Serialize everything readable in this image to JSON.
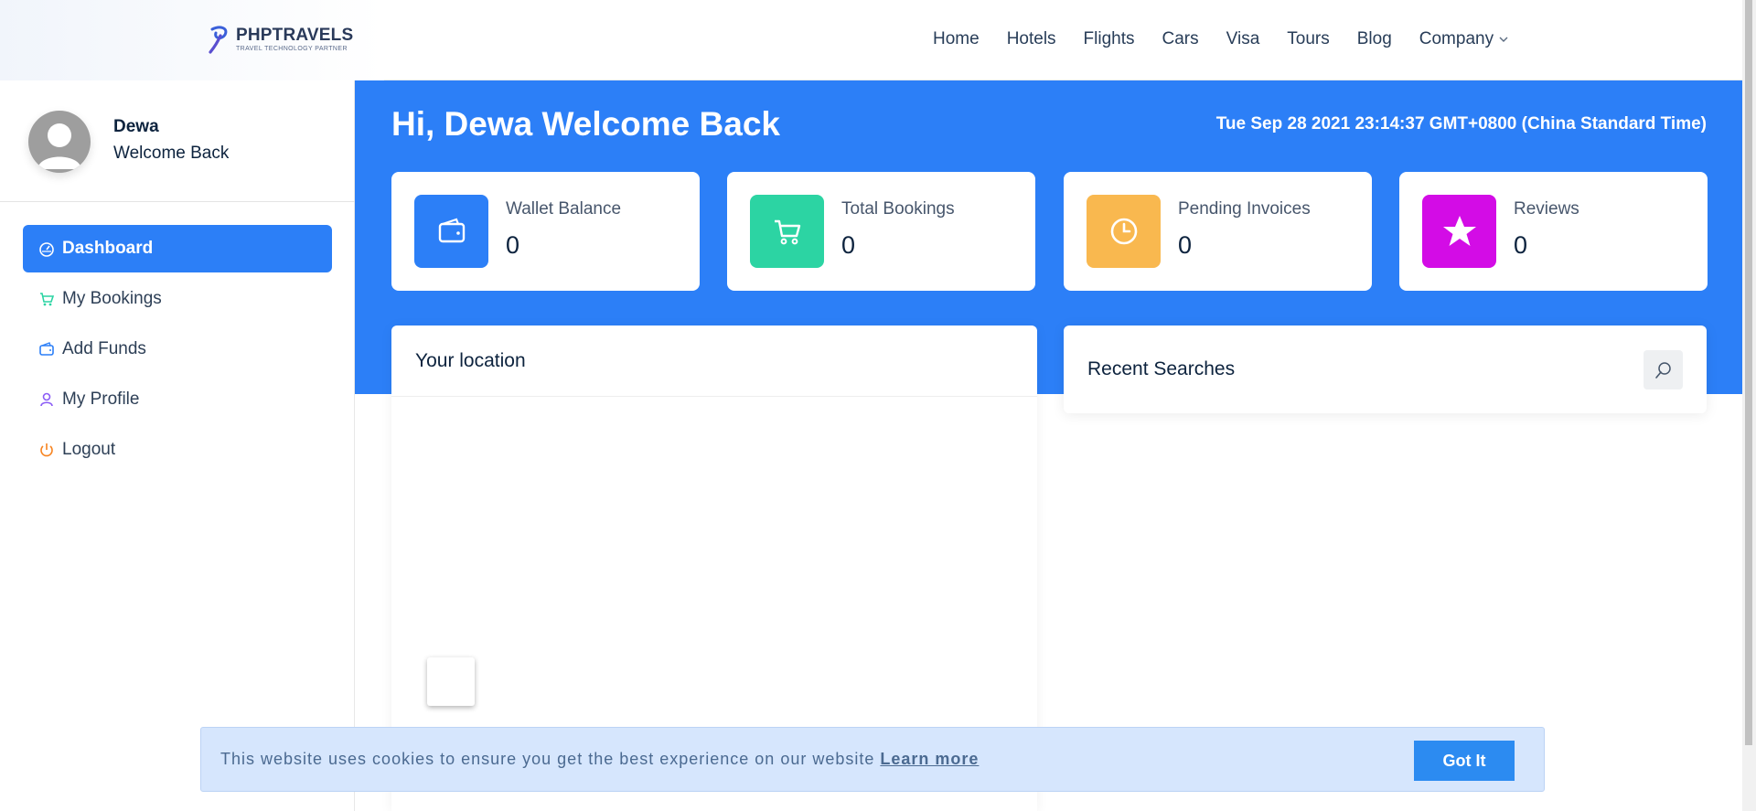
{
  "brand": {
    "name": "PHPTRAVELS",
    "tagline": "TRAVEL TECHNOLOGY PARTNER"
  },
  "nav": {
    "items": [
      "Home",
      "Hotels",
      "Flights",
      "Cars",
      "Visa",
      "Tours",
      "Blog",
      "Company"
    ],
    "company_icon": "chevron-down-icon"
  },
  "user": {
    "name": "Dewa",
    "welcome": "Welcome Back",
    "avatar_icon": "user-avatar-icon"
  },
  "sidebar": {
    "items": [
      {
        "label": "Dashboard",
        "icon": "speedometer-icon",
        "active": true
      },
      {
        "label": "My Bookings",
        "icon": "cart-icon",
        "active": false
      },
      {
        "label": "Add Funds",
        "icon": "wallet-icon",
        "active": false
      },
      {
        "label": "My Profile",
        "icon": "user-icon",
        "active": false
      },
      {
        "label": "Logout",
        "icon": "power-icon",
        "active": false
      }
    ]
  },
  "hero": {
    "title": "Hi, Dewa Welcome Back",
    "datetime": "Tue Sep 28 2021 23:14:37 GMT+0800 (China Standard Time)"
  },
  "stats": [
    {
      "label": "Wallet Balance",
      "value": "0",
      "icon": "wallet-icon",
      "color": "#2c7ff7"
    },
    {
      "label": "Total Bookings",
      "value": "0",
      "icon": "cart-icon",
      "color": "#2cd4a3"
    },
    {
      "label": "Pending Invoices",
      "value": "0",
      "icon": "clock-icon",
      "color": "#f9b84f"
    },
    {
      "label": "Reviews",
      "value": "0",
      "icon": "star-icon",
      "color": "#d30ce6"
    }
  ],
  "location": {
    "title": "Your location"
  },
  "searches": {
    "title": "Recent Searches",
    "icon": "search-icon"
  },
  "cookie": {
    "text": "This website uses cookies to ensure you get the best experience on our website",
    "link": "Learn more",
    "button": "Got It"
  },
  "colors": {
    "primary": "#2c7ff7",
    "text_dark": "#0d233e"
  }
}
